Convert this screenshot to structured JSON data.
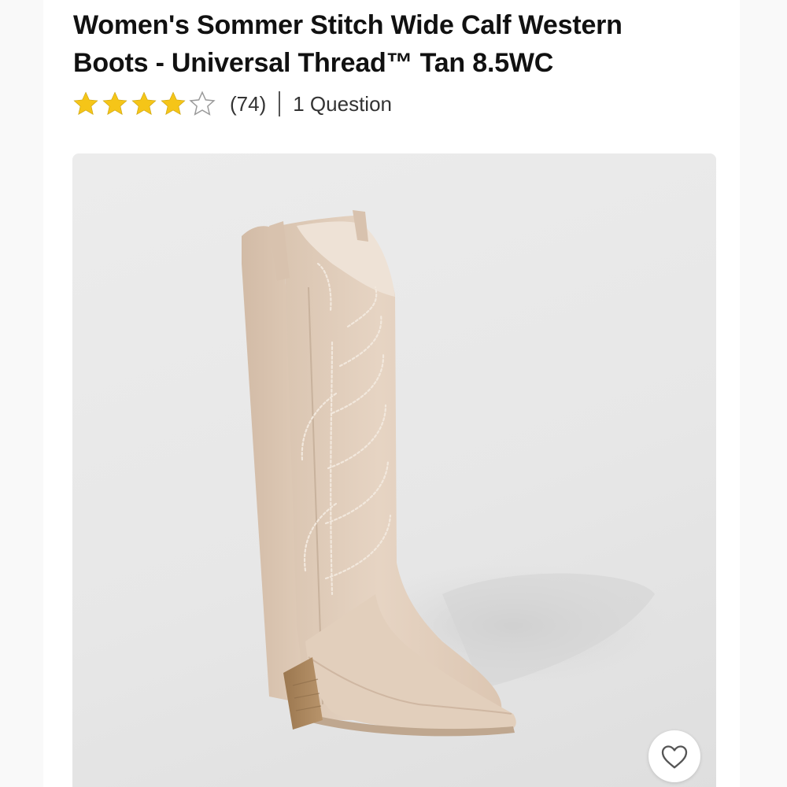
{
  "product": {
    "title": "Women's Sommer Stitch Wide Calf Western Boots - Universal Thread™ Tan 8.5WC",
    "rating": {
      "value": 4,
      "max": 5,
      "review_count_text": "(74)",
      "questions_text": "1 Question"
    },
    "image": {
      "subject": "tan suede knee-high western boot with embroidered stitching"
    }
  },
  "colors": {
    "star_filled": "#F5C518",
    "star_empty_outline": "#9a9a9a",
    "title_text": "#111111",
    "boot_suede": "#E3D0BE",
    "heel_wood": "#A88562",
    "image_background": "#E9E9E9"
  },
  "icons": {
    "star": "star-icon",
    "favorite": "heart-outline-icon"
  }
}
